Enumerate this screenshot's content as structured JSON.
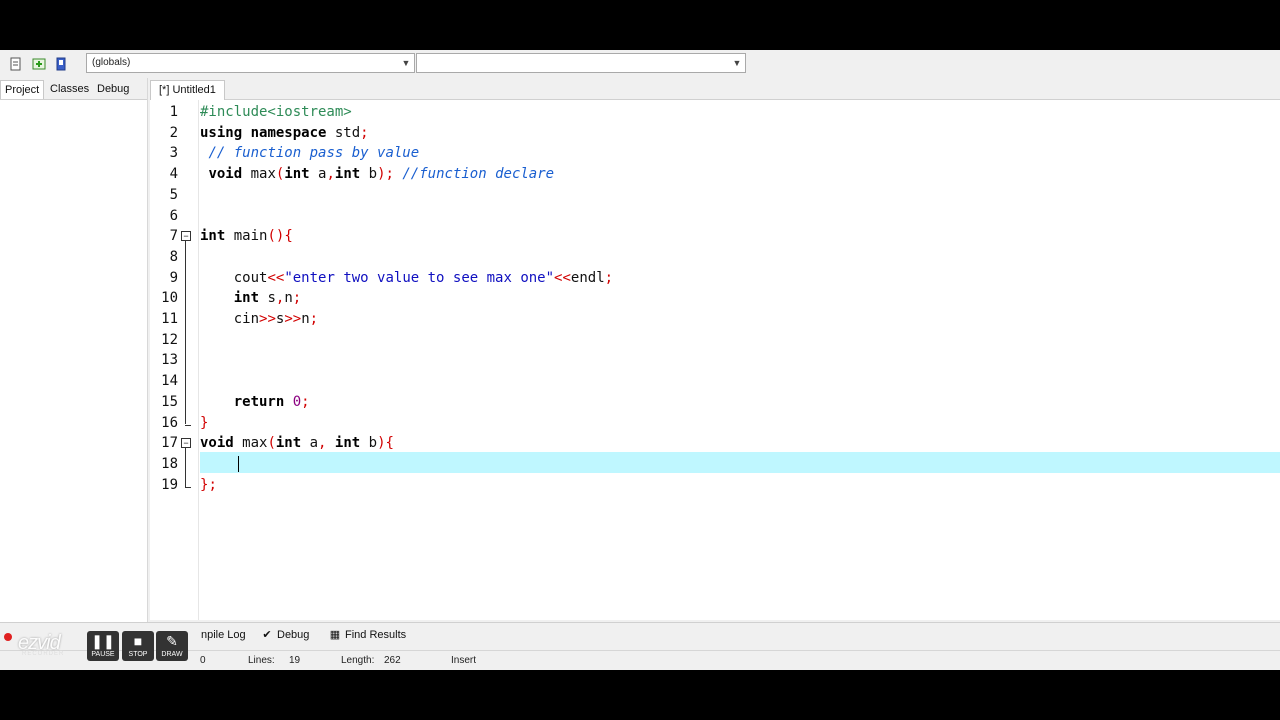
{
  "toolbar": {
    "combo_left_value": "(globals)",
    "combo_right_value": ""
  },
  "left_panel": {
    "tabs": [
      "Project",
      "Classes",
      "Debug"
    ]
  },
  "editor_tab": {
    "label": "[*] Untitled1"
  },
  "code_lines": [
    "#include<iostream>",
    "using namespace std;",
    " // function pass by value",
    " void max(int a,int b); //function declare",
    "",
    "",
    "int main(){",
    "",
    "    cout<<\"enter two value to see max one\"<<endl;",
    "    int s,n;",
    "    cin>>s>>n;",
    "",
    "",
    "",
    "    return 0;",
    "}",
    "void max(int a, int b){",
    "    ",
    "};"
  ],
  "line_numbers": [
    "1",
    "2",
    "3",
    "4",
    "5",
    "6",
    "7",
    "8",
    "9",
    "10",
    "11",
    "12",
    "13",
    "14",
    "15",
    "16",
    "17",
    "18",
    "19"
  ],
  "bottom_tabs": [
    "npile Log",
    "Debug",
    "Find Results"
  ],
  "status": {
    "col_value": "0",
    "lines_label": "Lines:",
    "lines_value": "19",
    "length_label": "Length:",
    "length_value": "262",
    "mode": "Insert"
  },
  "recorder": {
    "logo": "ezvid",
    "sub": "RECORDER",
    "pause_label": "PAUSE",
    "stop_label": "STOP",
    "draw_label": "DRAW"
  }
}
